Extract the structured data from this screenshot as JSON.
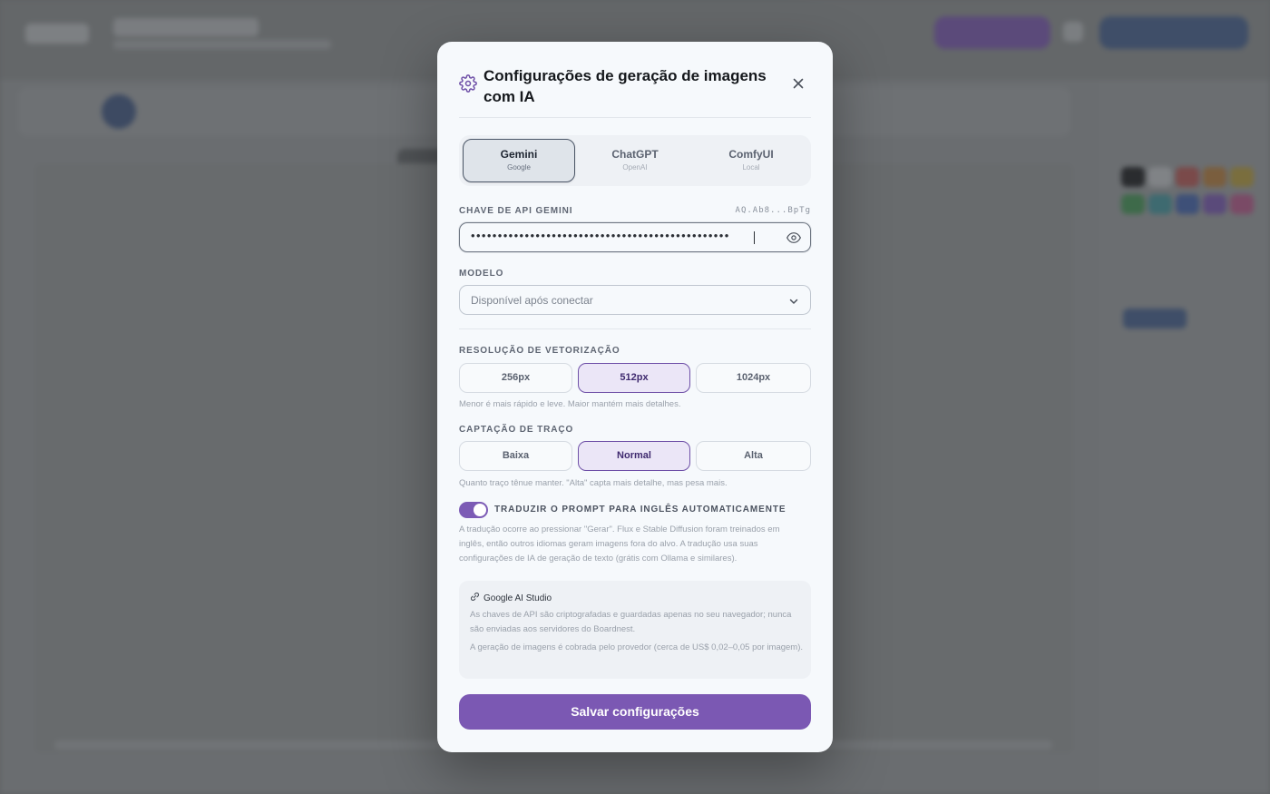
{
  "dialog": {
    "title": "Configurações de geração de imagens com IA",
    "icon": "gear-icon"
  },
  "providers": {
    "selected": "Gemini",
    "tabs": [
      {
        "label": "Gemini",
        "sub": "Google"
      },
      {
        "label": "ChatGPT",
        "sub": "OpenAI"
      },
      {
        "label": "ComfyUI",
        "sub": "Local"
      }
    ]
  },
  "api_key": {
    "label": "CHAVE DE API GEMINI",
    "masked_hint": "AQ.Ab8...BpTg",
    "value": "••••••••••••••••••••••••••••••••••••••••••••••••"
  },
  "model": {
    "label": "MODELO",
    "placeholder": "Disponível após conectar"
  },
  "vectorization": {
    "label": "RESOLUÇÃO DE VETORIZAÇÃO",
    "options": [
      "256px",
      "512px",
      "1024px"
    ],
    "selected": "512px",
    "hint": "Menor é mais rápido e leve. Maior mantém mais detalhes."
  },
  "stroke": {
    "label": "CAPTAÇÃO DE TRAÇO",
    "options": [
      "Baixa",
      "Normal",
      "Alta"
    ],
    "selected": "Normal",
    "hint": "Quanto traço tênue manter. \"Alta\" capta mais detalhe, mas pesa mais."
  },
  "translate": {
    "enabled": true,
    "label": "TRADUZIR O PROMPT PARA INGLÊS AUTOMATICAMENTE",
    "description": "A tradução ocorre ao pressionar \"Gerar\". Flux e Stable Diffusion foram treinados em inglês, então outros idiomas geram imagens fora do alvo. A tradução usa suas configurações de IA de geração de texto (grátis com Ollama e similares)."
  },
  "info": {
    "link_label": "Google AI Studio",
    "privacy": "As chaves de API são criptografadas e guardadas apenas no seu navegador; nunca são enviadas aos servidores do Boardnest.",
    "pricing": "A geração de imagens é cobrada pelo provedor (cerca de US$ 0,02–0,05 por imagem)."
  },
  "save_label": "Salvar configurações",
  "colors": {
    "accent": "#7b58b3",
    "toggle": "#7c5bb5",
    "selected_border": "#6e4fa7",
    "selected_bg": "#ebe6f7"
  }
}
